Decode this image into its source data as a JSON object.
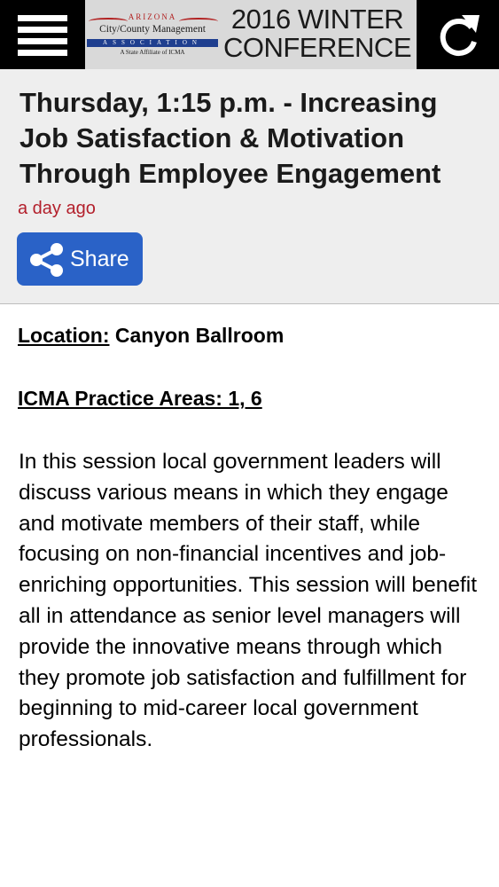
{
  "header": {
    "logo": {
      "state": "ARIZONA",
      "name": "City/County Management",
      "association": "ASSOCIATION",
      "affiliation": "A State Affiliate of ICMA"
    },
    "conference_line1": "2016 WINTER",
    "conference_line2": "CONFERENCE",
    "menu_icon": "hamburger-icon",
    "refresh_icon": "refresh-icon"
  },
  "session": {
    "title": "Thursday, 1:15 p.m. - Increasing Job Satisfaction & Motivation Through Employee Engagement",
    "timestamp": "a day ago",
    "share_label": "Share",
    "share_icon": "share-icon"
  },
  "details": {
    "location_label": "Location:",
    "location_value": "Canyon Ballroom",
    "practice_areas": "ICMA Practice Areas: 1, 6",
    "description": "In this session local government leaders will discuss various means in which they engage and motivate members of their staff, while focusing on non-financial incentives and job-enriching opportunities. This session will benefit all in attendance as senior level managers will provide the innovative means through which they promote job satisfaction and fulfillment for beginning to mid-career local government professionals."
  },
  "colors": {
    "topbar": "#000000",
    "banner": "#d9d9d9",
    "header_bg": "#eeeeee",
    "timestamp": "#b3202c",
    "share_button": "#2a62c7"
  }
}
